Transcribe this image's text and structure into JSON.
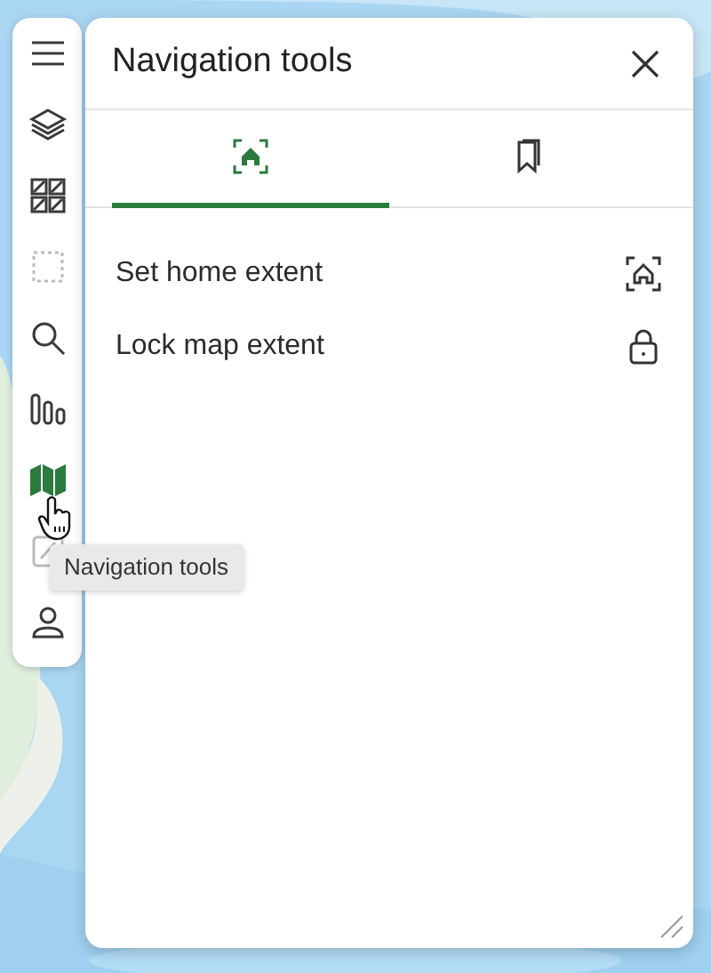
{
  "sidebar": {
    "items": [
      {
        "kind": "menu",
        "selected": false,
        "disabled": false
      },
      {
        "kind": "layers",
        "selected": false,
        "disabled": false
      },
      {
        "kind": "gallery",
        "selected": false,
        "disabled": false
      },
      {
        "kind": "select",
        "selected": false,
        "disabled": true
      },
      {
        "kind": "search",
        "selected": false,
        "disabled": false
      },
      {
        "kind": "bars",
        "selected": false,
        "disabled": false
      },
      {
        "kind": "map",
        "selected": true,
        "disabled": false
      },
      {
        "kind": "edit",
        "selected": false,
        "disabled": true
      },
      {
        "kind": "person",
        "selected": false,
        "disabled": false
      }
    ]
  },
  "tooltip": {
    "text": "Navigation tools"
  },
  "panel": {
    "title": "Navigation tools",
    "tabs": [
      {
        "kind": "home",
        "selected": true
      },
      {
        "kind": "bookmark",
        "selected": false
      }
    ],
    "items": [
      {
        "label": "Set home extent",
        "kind": "home"
      },
      {
        "label": "Lock map extent",
        "kind": "lock"
      }
    ]
  }
}
